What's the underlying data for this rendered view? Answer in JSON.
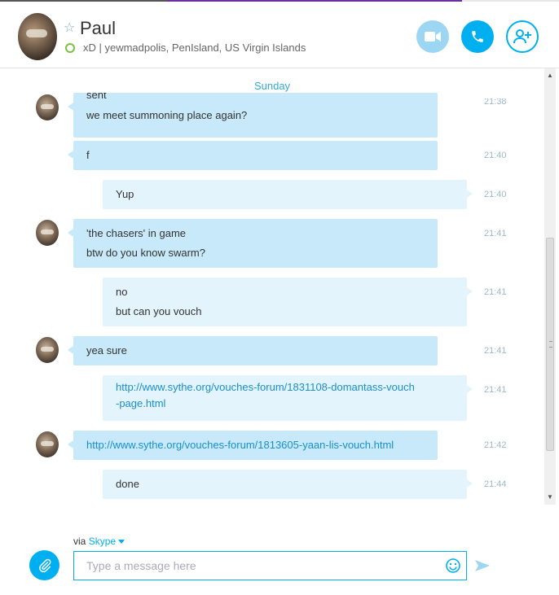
{
  "header": {
    "name": "Paul",
    "mood": "xD  |  yewmadpolis, PenIsland, US Virgin Islands",
    "icons": {
      "favorite": "star-icon",
      "presence": "online-status-icon",
      "video": "video-call-icon",
      "call": "phone-call-icon",
      "add": "add-contact-icon"
    },
    "colors": {
      "accent": "#00aff0",
      "video_button": "#9dd6f2",
      "presence_online": "#7cc242"
    }
  },
  "conversation": {
    "day_header": "Sunday",
    "messages": [
      {
        "from": "them",
        "lines": [
          "sent",
          "we meet summoning place again?"
        ],
        "time": "21:38"
      },
      {
        "from": "them",
        "lines": [
          "f"
        ],
        "time": "21:40"
      },
      {
        "from": "me",
        "lines": [
          "Yup"
        ],
        "time": "21:40"
      },
      {
        "from": "them",
        "lines": [
          "'the chasers' in game",
          "btw do you know swarm?"
        ],
        "time": "21:41"
      },
      {
        "from": "me",
        "lines": [
          "no",
          "but can you vouch"
        ],
        "time": "21:41"
      },
      {
        "from": "them",
        "lines": [
          "yea sure"
        ],
        "time": "21:41"
      },
      {
        "from": "me",
        "link": [
          "http://www.sythe.org/vouches-forum/1831108-domantass-vouch",
          "-page.html"
        ],
        "time": "21:41"
      },
      {
        "from": "them",
        "link": [
          "http://www.sythe.org/vouches-forum/1813605-yaan-lis-vouch.html"
        ],
        "time": "21:42"
      },
      {
        "from": "me",
        "lines": [
          "done"
        ],
        "time": "21:44"
      }
    ]
  },
  "composer": {
    "via_label": "via",
    "via_service": "Skype",
    "placeholder": "Type a message here",
    "icons": {
      "attach": "paperclip-icon",
      "emoji": "emoticon-icon",
      "send": "send-icon"
    }
  }
}
